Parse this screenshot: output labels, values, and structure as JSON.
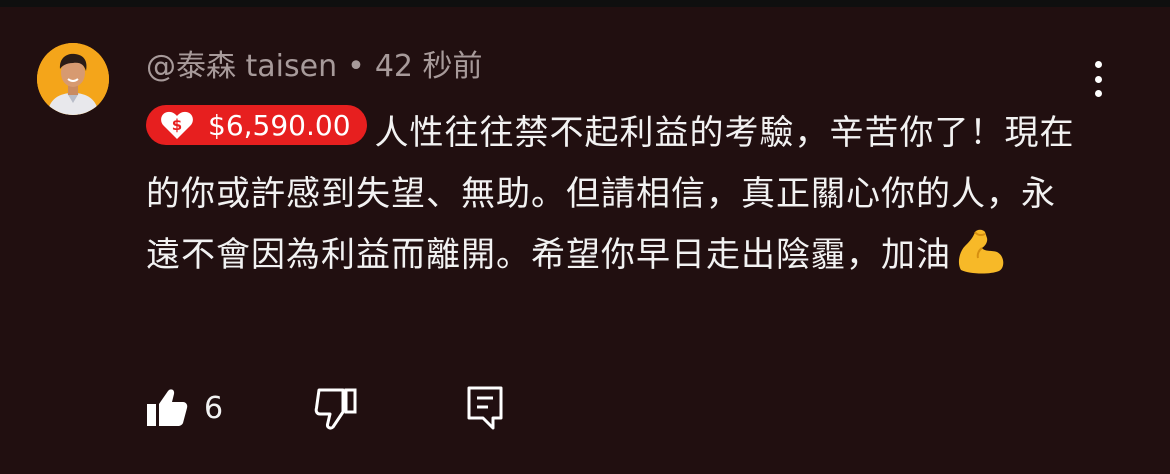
{
  "comment": {
    "handle": "@泰森 taisen",
    "separator": "•",
    "timestamp": "42 秒前",
    "avatar_bg": "#f4a51a",
    "super_thanks": {
      "amount": "$6,590.00",
      "color": "#e71f1f",
      "icon": "super-thanks-heart-icon"
    },
    "text": "人性往往禁不起利益的考驗，辛苦你了！現在的你或許感到失望、無助。但請相信，真正關心你的人，永遠不會因為利益而離開。希望你早日走出陰霾，加油",
    "emoji": "flexed-biceps-emoji"
  },
  "actions": {
    "like_count": "6",
    "like_icon": "thumbs-up-icon",
    "dislike_icon": "thumbs-down-icon",
    "reply_icon": "reply-comment-icon"
  },
  "menu": {
    "icon": "more-vertical-icon"
  }
}
